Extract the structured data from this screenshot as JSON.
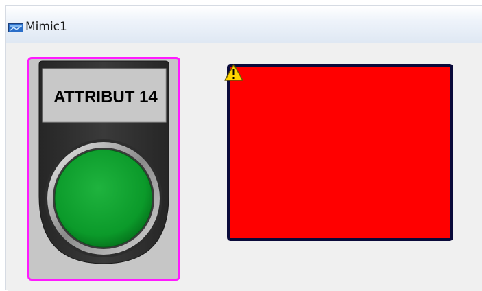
{
  "window": {
    "title": "Mimic1",
    "icon": "mimic-window-icon"
  },
  "pushbutton": {
    "label": "ATTRIBUT 14",
    "lamp_color": "#0b9a2a",
    "selection_color": "#ff1aff",
    "body_color": "#333333",
    "label_background": "#c8c8c8"
  },
  "alarm_shape": {
    "fill_color": "#ff0000",
    "border_color": "#0a0a3a",
    "status_icon": "warning-icon",
    "status_icon_color": "#ffd400"
  }
}
